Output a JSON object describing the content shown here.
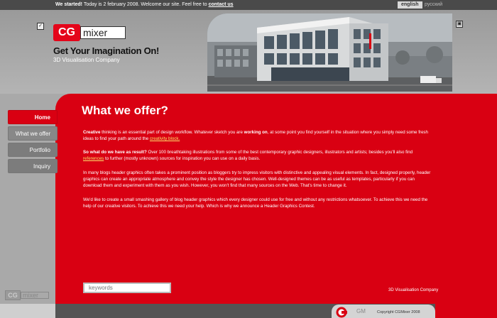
{
  "topbar": {
    "started_label": "We started!",
    "message": " Today is 2 february 2008. Welcome our site. Feel free to ",
    "contact_link": "contact us",
    "lang_english": "english",
    "lang_russian": "русский"
  },
  "header": {
    "logo_cg": "CG",
    "logo_mixer": "mixer",
    "tagline": "Get Your Imagination On!",
    "subtitle": "3D Visualisation Company",
    "left_icon": "check-icon",
    "right_icon": "window-icon"
  },
  "nav": {
    "items": [
      {
        "label": "Home"
      },
      {
        "label": "What we offer"
      },
      {
        "label": "Portfolio"
      },
      {
        "label": "Inquiry"
      }
    ]
  },
  "main": {
    "title": "What we offer?",
    "p1_bold1": "Creative",
    "p1_text1": " thinking is an essential part of design workflow. Whatever sketch you are ",
    "p1_bold2": "working on",
    "p1_text2": ", at some point you find yourself in the situation where you simply need some fresh ideas to find your path around the ",
    "p1_link": "creativity block.",
    "p2_bold": "So what do we have as result?",
    "p2_text1": " Over 100 breathtaking illustrations from some of the best contemporary graphic designers, illustrators and artists; besides you'll also find ",
    "p2_link": "references",
    "p2_text2": " to further (mostly unknown) sources for inspiration you can use on a daily basis.",
    "p3": "In many blogs header graphics often takes a prominent position as bloggers try to impress visitors with distinctive and appealing visual elements. In fact, designed properly, header graphics can create an appropriate atmosphere and convey the style the designer has chosen. Well-designed themes can be as useful as templates, particularly if you can download them and experiment with them as you wish. However, you won't find that many sources on the Web. That's time to change it.",
    "p4": "We'd like to create a small smashing gallery of blog header graphics which every designer could use for free and without any restrictions whatsoever. To achieve this we need the help of our creative visitors. To achieve this we need your help. Which is why we announce a Header Graphics Contest.",
    "search_placeholder": "keywords",
    "company": "3D Visualisation Company"
  },
  "footer": {
    "copyright": "Copyright CGMixer 2008",
    "logo_partial": "GM",
    "bottom_logo_cg": "CG",
    "bottom_logo_mixer": "mixer"
  },
  "colors": {
    "accent_red": "#d90012",
    "background_gray": "#a9a9a9",
    "topbar": "#4a4a4a"
  }
}
